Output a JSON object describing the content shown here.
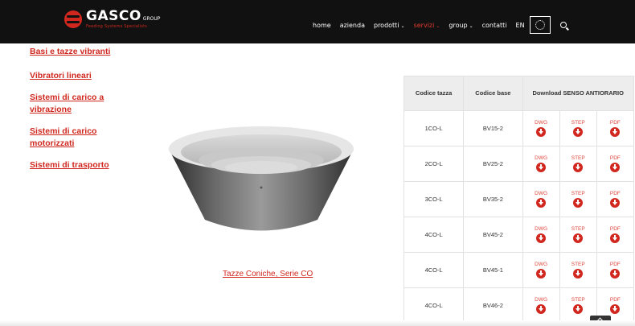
{
  "header": {
    "logo_main": "GASCO",
    "logo_group": "GROUP",
    "logo_tagline": "Feeding Systems Specialists",
    "nav": [
      {
        "label": "home",
        "caret": false,
        "active": false
      },
      {
        "label": "azienda",
        "caret": false,
        "active": false
      },
      {
        "label": "prodotti",
        "caret": true,
        "active": false
      },
      {
        "label": "servizi",
        "caret": true,
        "active": true
      },
      {
        "label": "group",
        "caret": true,
        "active": false
      },
      {
        "label": "contatti",
        "caret": false,
        "active": false
      },
      {
        "label": "EN",
        "caret": false,
        "active": false
      }
    ]
  },
  "sidebar": {
    "links": [
      "Basi e tazze vibranti",
      "Vibratori lineari",
      "Sistemi di carico a vibrazione",
      "Sistemi di carico motorizzati",
      "Sistemi di trasporto"
    ]
  },
  "product": {
    "caption": "Tazze Coniche, Serie CO"
  },
  "table": {
    "headers": {
      "codice_tazza": "Codice tazza",
      "codice_base": "Codice base",
      "download": "Download SENSO ANTIORARIO"
    },
    "download_labels": [
      "DWG",
      "STEP",
      "PDF"
    ],
    "rows": [
      {
        "tazza": "1CO-L",
        "base": "BV15-2"
      },
      {
        "tazza": "2CO-L",
        "base": "BV25-2"
      },
      {
        "tazza": "3CO-L",
        "base": "BV35-2"
      },
      {
        "tazza": "4CO-L",
        "base": "BV45-2"
      },
      {
        "tazza": "4CO-L",
        "base": "BV45-1"
      },
      {
        "tazza": "4CO-L",
        "base": "BV46-2"
      }
    ]
  },
  "colors": {
    "brand_red": "#d0281f",
    "header_bg": "#111111"
  }
}
